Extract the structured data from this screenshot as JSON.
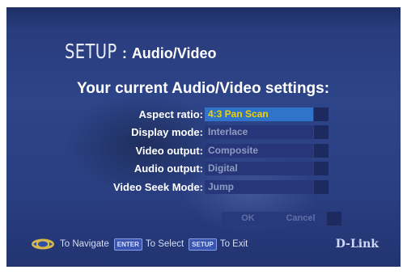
{
  "header": {
    "setup_word": "SETUP",
    "separator": ":",
    "section": "Audio/Video"
  },
  "heading": "Your current Audio/Video settings:",
  "settings": [
    {
      "label": "Aspect ratio:",
      "value": "4:3 Pan Scan"
    },
    {
      "label": "Display mode:",
      "value": "Interlace"
    },
    {
      "label": "Video output:",
      "value": "Composite"
    },
    {
      "label": "Audio output:",
      "value": "Digital"
    },
    {
      "label": "Video Seek Mode:",
      "value": "Jump"
    }
  ],
  "buttons": {
    "ok": "OK",
    "cancel": "Cancel"
  },
  "footer": {
    "navigate": "To Navigate",
    "enter_key": "ENTER",
    "select": "To Select",
    "setup_key": "SETUP",
    "exit": "To Exit",
    "brand": "D-Link"
  },
  "colors": {
    "background": "#2b4184",
    "selected_value_bg": "#2f74c8",
    "selected_value_text": "#f2d100",
    "inactive_value_text": "#8f9cc2"
  },
  "icons": [
    "dpad-navigate-icon"
  ]
}
